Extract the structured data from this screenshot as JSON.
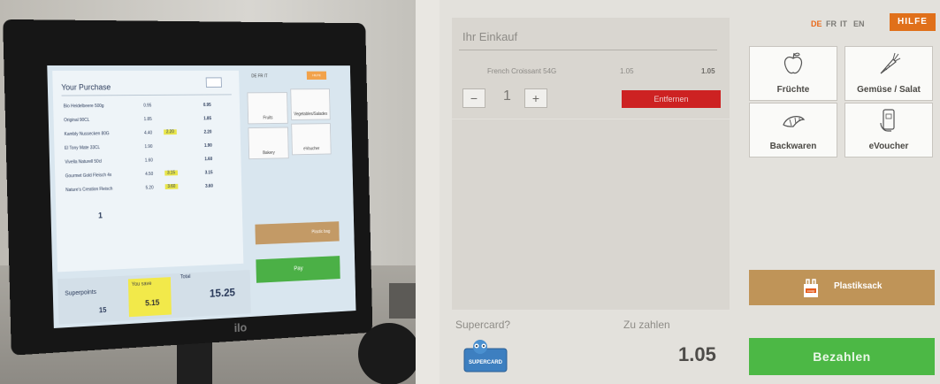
{
  "photo": {
    "screen": {
      "title": "Your Purchase",
      "items": [
        {
          "name": "Bio Heidelbeere 500g",
          "price": "0.95",
          "discount": "",
          "total": "0.95"
        },
        {
          "name": "Original 90CL",
          "price": "1.85",
          "discount": "",
          "total": "1.85"
        },
        {
          "name": "Kambly Nussecken 80G",
          "price": "4.40",
          "discount": "2.20",
          "total": "2.20"
        },
        {
          "name": "El Tony Mate 33CL",
          "price": "1.90",
          "discount": "",
          "total": "1.90"
        },
        {
          "name": "Vivella Naturell 50cl",
          "price": "1.60",
          "discount": "",
          "total": "1.60"
        },
        {
          "name": "Gourmet Gold Fleisch 4x",
          "price": "4.50",
          "discount": "3.15",
          "total": "3.15"
        },
        {
          "name": "Nature's Creation Fleisch",
          "price": "5.20",
          "discount": "3.60",
          "total": "3.60"
        }
      ],
      "quantity": "1",
      "languages": "DE FR IT",
      "help": "HILFE",
      "tiles": [
        "Fruits",
        "Vegetables/Salades",
        "Bakery",
        "eVoucher"
      ],
      "plastic_bag": "Plastic bag",
      "pay": "Pay",
      "superpoints_label": "Superpoints",
      "superpoints_value": "15",
      "you_save_label": "You save",
      "you_save_value": "5.15",
      "total_label": "Total",
      "total_value": "15.25"
    },
    "monitor_brand": "ilo"
  },
  "kiosk": {
    "cart_title": "Ihr Einkauf",
    "item": {
      "name": "French Croissant 54G",
      "price": "1.05",
      "total": "1.05",
      "quantity": "1"
    },
    "minus": "−",
    "plus": "+",
    "remove": "Entfernen",
    "supercard": "Supercard?",
    "supercard_logo_text": "SUPERCARD",
    "amount_due_label": "Zu zahlen",
    "amount_due": "1.05",
    "languages": [
      {
        "code": "DE",
        "active": true
      },
      {
        "code": "FR",
        "active": false
      },
      {
        "code": "IT",
        "active": false
      },
      {
        "code": "EN",
        "active": false
      }
    ],
    "help": "HILFE",
    "tiles": [
      {
        "label": "Früchte",
        "icon": "apple-icon"
      },
      {
        "label": "Gemüse / Salat",
        "icon": "carrot-icon"
      },
      {
        "label": "Backwaren",
        "icon": "croissant-icon"
      },
      {
        "label": "eVoucher",
        "icon": "phone-voucher-icon"
      }
    ],
    "plastic_bag": "Plastiksack",
    "bag_logo_text": "coop",
    "pay": "Bezahlen",
    "colors": {
      "accent": "#e0701a",
      "remove": "#cd2222",
      "pay": "#4cb845",
      "bag": "#bf9458"
    }
  }
}
